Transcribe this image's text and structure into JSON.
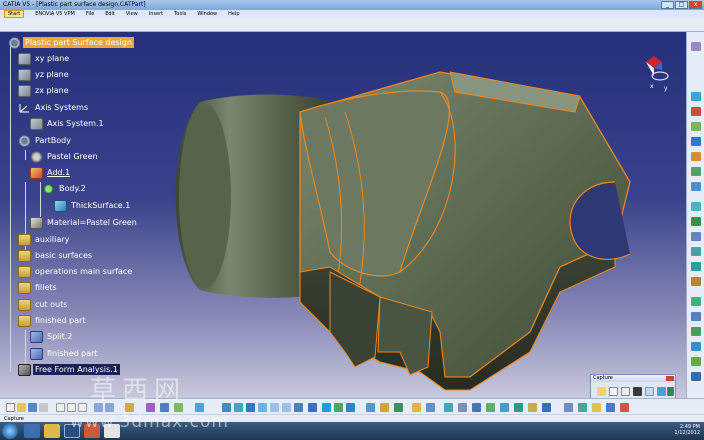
{
  "window": {
    "title": "CATIA V5 - [Plastic part surface design.CATPart]",
    "buttons": [
      "_",
      "□",
      "x"
    ]
  },
  "menu": [
    "Start",
    "ENOVIA V5 VPM",
    "File",
    "Edit",
    "View",
    "Insert",
    "Tools",
    "Window",
    "Help"
  ],
  "tree": {
    "root": "Plastic part Surface design",
    "items": [
      {
        "label": "xy plane",
        "icon": "plane-icon"
      },
      {
        "label": "yz plane",
        "icon": "plane-icon"
      },
      {
        "label": "zx plane",
        "icon": "plane-icon"
      },
      {
        "label": "Axis Systems",
        "icon": "axis-systems-icon"
      },
      {
        "label": "Axis System.1",
        "icon": "axis-system-icon"
      },
      {
        "label": "PartBody",
        "icon": "partbody-icon"
      },
      {
        "label": "Pastel Green",
        "icon": "appearance-icon"
      },
      {
        "label": "Add.1",
        "icon": "boolean-add-icon"
      },
      {
        "label": "Body.2",
        "icon": "body-icon"
      },
      {
        "label": "ThickSurface.1",
        "icon": "thick-surface-icon"
      },
      {
        "label": "Material=Pastel Green",
        "icon": "material-icon"
      },
      {
        "label": "auxiliary",
        "icon": "geometrical-set-icon"
      },
      {
        "label": "basic surfaces",
        "icon": "geometrical-set-icon"
      },
      {
        "label": "operations main surface",
        "icon": "geometrical-set-icon"
      },
      {
        "label": "fillets",
        "icon": "geometrical-set-icon"
      },
      {
        "label": "cut outs",
        "icon": "geometrical-set-icon"
      },
      {
        "label": "finished part",
        "icon": "geometrical-set-icon"
      },
      {
        "label": "Split.2",
        "icon": "split-icon"
      },
      {
        "label": "finished part",
        "icon": "split-icon"
      },
      {
        "label": "Free Form Analysis.1",
        "icon": "free-form-analysis-icon"
      }
    ]
  },
  "capture": {
    "title": "Capture"
  },
  "status": {
    "text": "Capture"
  },
  "clock": {
    "time": "2:49 PM",
    "date": "1/12/2012"
  },
  "watermark": {
    "chinese": "草西网",
    "url": "www.3dmax.com"
  },
  "colors": {
    "tree_root_highlight": "#f3a23b",
    "model_edges": "#f0871c",
    "model_surface": "#5b6a52",
    "viewport_top": "#26307a"
  }
}
